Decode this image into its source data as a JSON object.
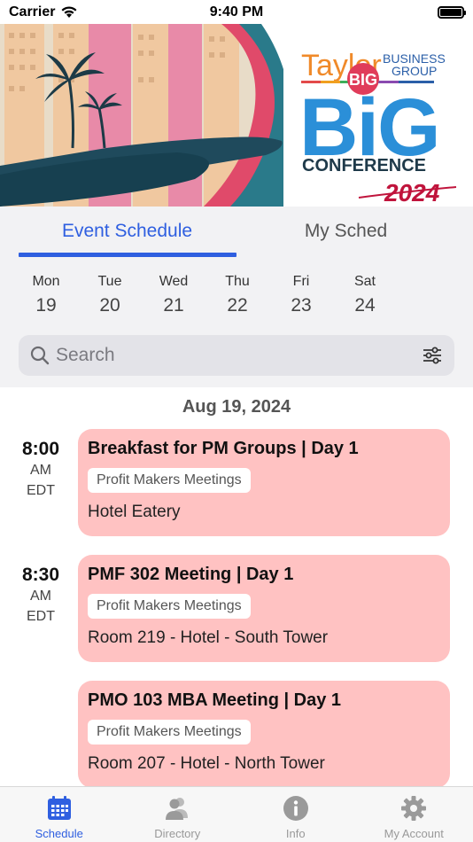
{
  "status_bar": {
    "carrier": "Carrier",
    "time": "9:40 PM"
  },
  "banner": {
    "brand_taylor": "Taylor",
    "brand_business": "BUSINESS",
    "brand_group": "GROUP",
    "big_badge": "BIG",
    "big_word": "BiG",
    "conference": "CONFERENCE",
    "year": "2024"
  },
  "tabs": {
    "event_schedule": "Event Schedule",
    "my_sched": "My Sched"
  },
  "days": [
    {
      "name": "Mon",
      "num": "19"
    },
    {
      "name": "Tue",
      "num": "20"
    },
    {
      "name": "Wed",
      "num": "21"
    },
    {
      "name": "Thu",
      "num": "22"
    },
    {
      "name": "Fri",
      "num": "23"
    },
    {
      "name": "Sat",
      "num": "24"
    }
  ],
  "search": {
    "placeholder": "Search"
  },
  "schedule": {
    "date": "Aug 19, 2024",
    "events": [
      {
        "time": "8:00",
        "ampm": "AM",
        "tz": "EDT",
        "title": "Breakfast for PM Groups | Day 1",
        "tag": "Profit Makers Meetings",
        "location": "Hotel Eatery"
      },
      {
        "time": "8:30",
        "ampm": "AM",
        "tz": "EDT",
        "title": "PMF 302 Meeting | Day 1",
        "tag": "Profit Makers Meetings",
        "location": "Room 219 - Hotel - South Tower"
      },
      {
        "time": "",
        "ampm": "",
        "tz": "",
        "title": "PMO 103 MBA Meeting | Day 1",
        "tag": "Profit Makers Meetings",
        "location": "Room 207 - Hotel - North Tower"
      }
    ]
  },
  "tabbar": {
    "items": [
      {
        "label": "Schedule",
        "icon": "calendar-icon",
        "active": true
      },
      {
        "label": "Directory",
        "icon": "people-icon",
        "active": false
      },
      {
        "label": "Info",
        "icon": "info-icon",
        "active": false
      },
      {
        "label": "My Account",
        "icon": "gear-icon",
        "active": false
      }
    ]
  },
  "colors": {
    "accent": "#2f5fe0",
    "card": "#ffc2c2",
    "brand_orange": "#f08a2a",
    "brand_red": "#c0143c",
    "brand_blue": "#2b8fd8"
  }
}
